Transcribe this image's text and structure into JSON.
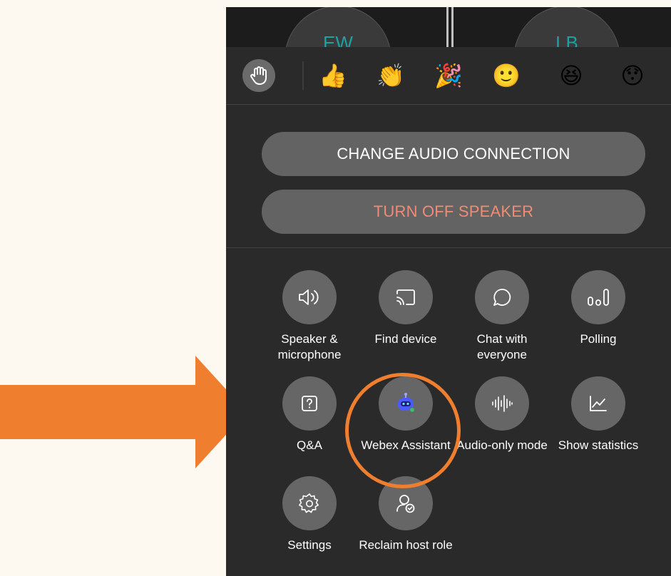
{
  "colors": {
    "page_bg": "#fdf9f0",
    "accent": "#f07e2f",
    "danger": "#f08b75"
  },
  "participants": [
    {
      "initials": "EW"
    },
    {
      "initials": "LB"
    }
  ],
  "reactions": {
    "raise_hand_icon": "raise-hand-icon",
    "items": [
      {
        "name": "thumbs-up",
        "glyph": "👍"
      },
      {
        "name": "clapping-hands",
        "glyph": "👏"
      },
      {
        "name": "party-popper",
        "glyph": "🎉"
      },
      {
        "name": "smiling-face",
        "glyph": "🙂"
      },
      {
        "name": "laughing-face",
        "glyph": "😆"
      },
      {
        "name": "surprised-face",
        "glyph": "😯"
      }
    ]
  },
  "audio": {
    "change_label": "CHANGE AUDIO CONNECTION",
    "speaker_label": "TURN OFF SPEAKER"
  },
  "options": [
    {
      "id": "speaker-microphone",
      "icon": "speaker-icon",
      "label": "Speaker & microphone"
    },
    {
      "id": "find-device",
      "icon": "cast-icon",
      "label": "Find device"
    },
    {
      "id": "chat",
      "icon": "chat-bubble-icon",
      "label": "Chat with everyone"
    },
    {
      "id": "polling",
      "icon": "poll-bars-icon",
      "label": "Polling"
    },
    {
      "id": "qa",
      "icon": "question-box-icon",
      "label": "Q&A"
    },
    {
      "id": "webex-assistant",
      "icon": "assistant-bot-icon",
      "label": "Webex Assistant"
    },
    {
      "id": "audio-only",
      "icon": "waveform-icon",
      "label": "Audio-only mode"
    },
    {
      "id": "statistics",
      "icon": "line-chart-icon",
      "label": "Show statistics"
    },
    {
      "id": "settings",
      "icon": "gear-icon",
      "label": "Settings"
    },
    {
      "id": "reclaim-host",
      "icon": "host-check-icon",
      "label": "Reclaim host role"
    }
  ]
}
